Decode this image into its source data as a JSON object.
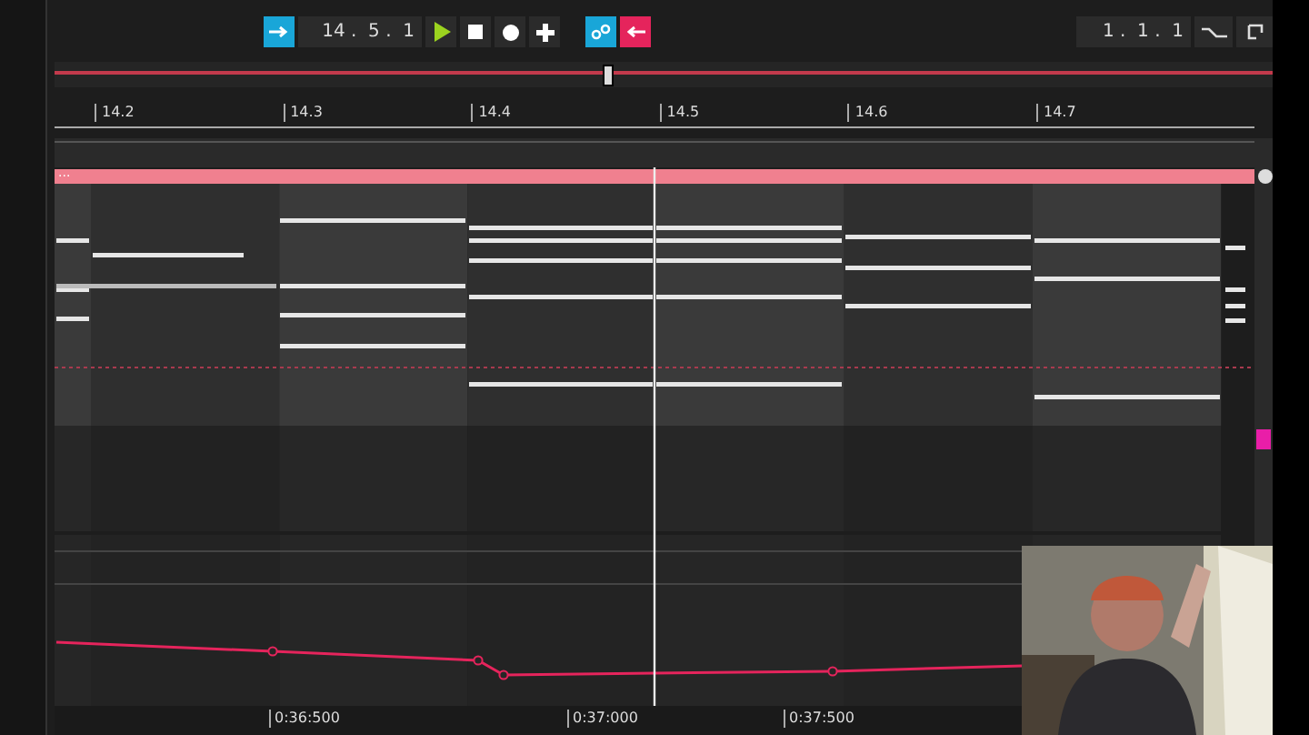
{
  "toolbar": {
    "position": "14 .  5 .  1",
    "loop_length": "1 .  1 .  1"
  },
  "ruler": {
    "labels": [
      "14.2",
      "14.3",
      "14.4",
      "14.5",
      "14.6",
      "14.7"
    ]
  },
  "clip": {
    "label": "..."
  },
  "timeline": {
    "labels": [
      "0:36:500",
      "0:37:000",
      "0:37:500"
    ]
  }
}
